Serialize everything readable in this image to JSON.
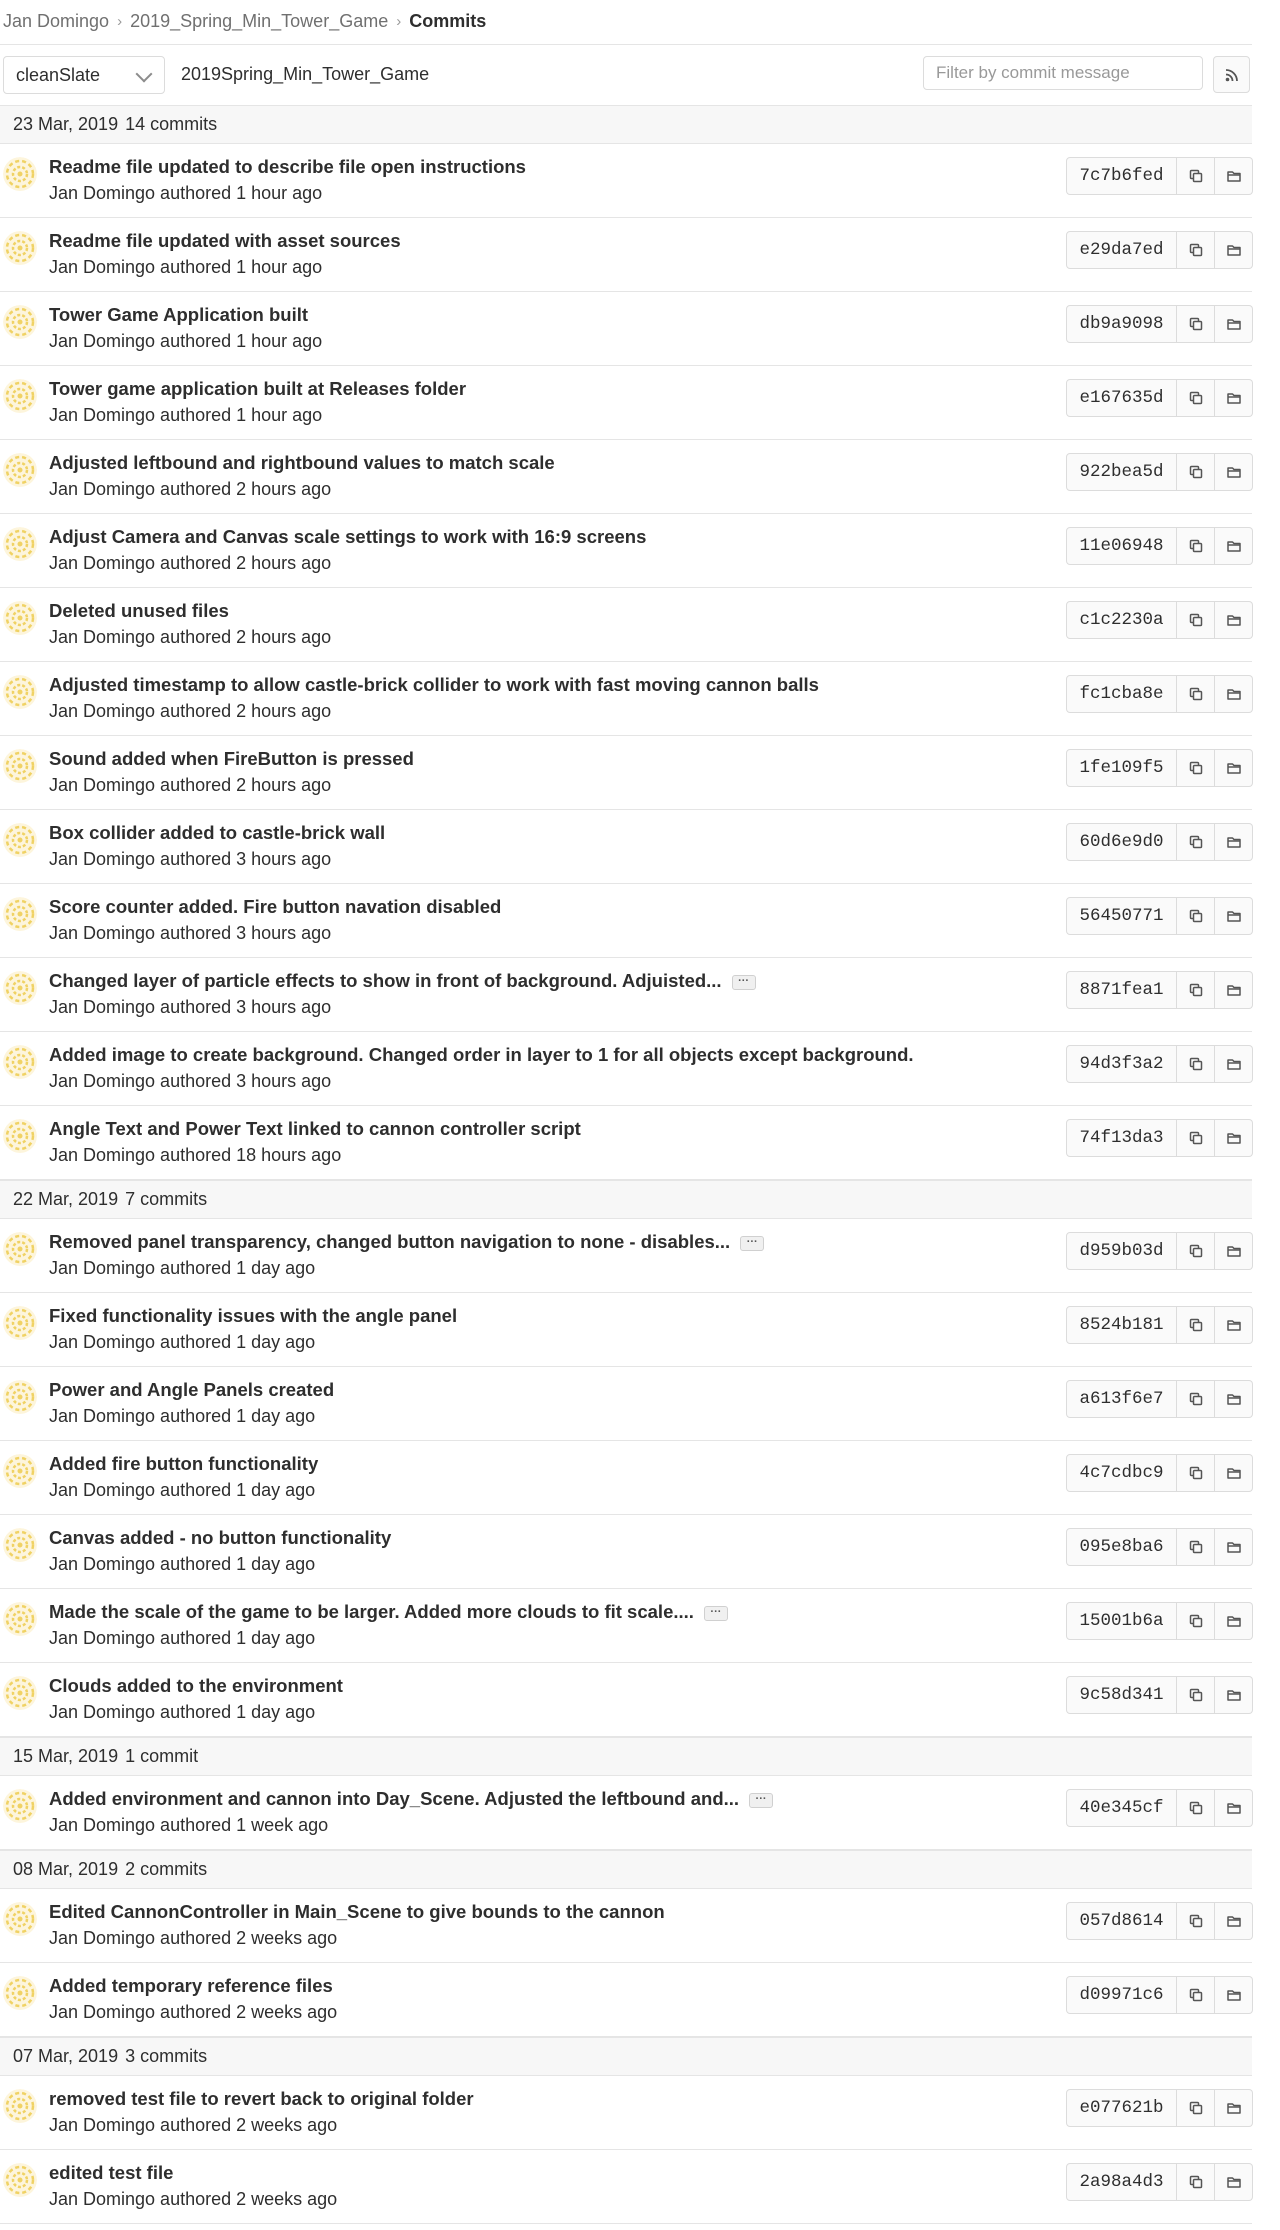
{
  "breadcrumb": {
    "user": "Jan Domingo",
    "project": "2019_Spring_Min_Tower_Game",
    "current": "Commits"
  },
  "toolbar": {
    "branch": "cleanSlate",
    "project_name": "2019Spring_Min_Tower_Game",
    "filter_placeholder": "Filter by commit message"
  },
  "icons": {
    "chevron": "chevron-down-icon",
    "rss": "rss-icon",
    "copy": "copy-icon",
    "browse": "folder-icon",
    "avatar": "identicon-avatar",
    "ellipsis": "ellipsis-icon"
  },
  "colors": {
    "avatar": "#f0d264",
    "border": "#e5e5e5",
    "header_bg": "#f7f7f7"
  },
  "groups": [
    {
      "date": "23 Mar, 2019",
      "count": "14 commits",
      "commits": [
        {
          "title": "Readme file updated to describe file open instructions",
          "meta": "Jan Domingo authored 1 hour ago",
          "sha": "7c7b6fed",
          "truncated": false
        },
        {
          "title": "Readme file updated with asset sources",
          "meta": "Jan Domingo authored 1 hour ago",
          "sha": "e29da7ed",
          "truncated": false
        },
        {
          "title": "Tower Game Application built",
          "meta": "Jan Domingo authored 1 hour ago",
          "sha": "db9a9098",
          "truncated": false
        },
        {
          "title": "Tower game application built at Releases folder",
          "meta": "Jan Domingo authored 1 hour ago",
          "sha": "e167635d",
          "truncated": false
        },
        {
          "title": "Adjusted leftbound and rightbound values to match scale",
          "meta": "Jan Domingo authored 2 hours ago",
          "sha": "922bea5d",
          "truncated": false
        },
        {
          "title": "Adjust Camera and Canvas scale settings to work with 16:9 screens",
          "meta": "Jan Domingo authored 2 hours ago",
          "sha": "11e06948",
          "truncated": false
        },
        {
          "title": "Deleted unused files",
          "meta": "Jan Domingo authored 2 hours ago",
          "sha": "c1c2230a",
          "truncated": false
        },
        {
          "title": "Adjusted timestamp to allow castle-brick collider to work with fast moving cannon balls",
          "meta": "Jan Domingo authored 2 hours ago",
          "sha": "fc1cba8e",
          "truncated": false
        },
        {
          "title": "Sound added when FireButton is pressed",
          "meta": "Jan Domingo authored 2 hours ago",
          "sha": "1fe109f5",
          "truncated": false
        },
        {
          "title": "Box collider added to castle-brick wall",
          "meta": "Jan Domingo authored 3 hours ago",
          "sha": "60d6e9d0",
          "truncated": false
        },
        {
          "title": "Score counter added. Fire button navation disabled",
          "meta": "Jan Domingo authored 3 hours ago",
          "sha": "56450771",
          "truncated": false
        },
        {
          "title": "Changed layer of particle effects to show in front of background. Adjuisted...",
          "meta": "Jan Domingo authored 3 hours ago",
          "sha": "8871fea1",
          "truncated": true
        },
        {
          "title": "Added image to create background. Changed order in layer to 1 for all objects except background.",
          "meta": "Jan Domingo authored 3 hours ago",
          "sha": "94d3f3a2",
          "truncated": false
        },
        {
          "title": "Angle Text and Power Text linked to cannon controller script",
          "meta": "Jan Domingo authored 18 hours ago",
          "sha": "74f13da3",
          "truncated": false
        }
      ]
    },
    {
      "date": "22 Mar, 2019",
      "count": "7 commits",
      "commits": [
        {
          "title": "Removed panel transparency, changed button navigation to none - disables...",
          "meta": "Jan Domingo authored 1 day ago",
          "sha": "d959b03d",
          "truncated": true
        },
        {
          "title": "Fixed functionality issues with the angle panel",
          "meta": "Jan Domingo authored 1 day ago",
          "sha": "8524b181",
          "truncated": false
        },
        {
          "title": "Power and Angle Panels created",
          "meta": "Jan Domingo authored 1 day ago",
          "sha": "a613f6e7",
          "truncated": false
        },
        {
          "title": "Added fire button functionality",
          "meta": "Jan Domingo authored 1 day ago",
          "sha": "4c7cdbc9",
          "truncated": false
        },
        {
          "title": "Canvas added - no button functionality",
          "meta": "Jan Domingo authored 1 day ago",
          "sha": "095e8ba6",
          "truncated": false
        },
        {
          "title": "Made the scale of the game to be larger. Added more clouds to fit scale....",
          "meta": "Jan Domingo authored 1 day ago",
          "sha": "15001b6a",
          "truncated": true
        },
        {
          "title": "Clouds added to the environment",
          "meta": "Jan Domingo authored 1 day ago",
          "sha": "9c58d341",
          "truncated": false
        }
      ]
    },
    {
      "date": "15 Mar, 2019",
      "count": "1 commit",
      "commits": [
        {
          "title": "Added environment and cannon into Day_Scene. Adjusted the leftbound and...",
          "meta": "Jan Domingo authored 1 week ago",
          "sha": "40e345cf",
          "truncated": true
        }
      ]
    },
    {
      "date": "08 Mar, 2019",
      "count": "2 commits",
      "commits": [
        {
          "title": "Edited CannonController in Main_Scene to give bounds to the cannon",
          "meta": "Jan Domingo authored 2 weeks ago",
          "sha": "057d8614",
          "truncated": false
        },
        {
          "title": "Added temporary reference files",
          "meta": "Jan Domingo authored 2 weeks ago",
          "sha": "d09971c6",
          "truncated": false
        }
      ]
    },
    {
      "date": "07 Mar, 2019",
      "count": "3 commits",
      "commits": [
        {
          "title": "removed test file to revert back to original folder",
          "meta": "Jan Domingo authored 2 weeks ago",
          "sha": "e077621b",
          "truncated": false
        },
        {
          "title": "edited test file",
          "meta": "Jan Domingo authored 2 weeks ago",
          "sha": "2a98a4d3",
          "truncated": false
        }
      ]
    }
  ]
}
